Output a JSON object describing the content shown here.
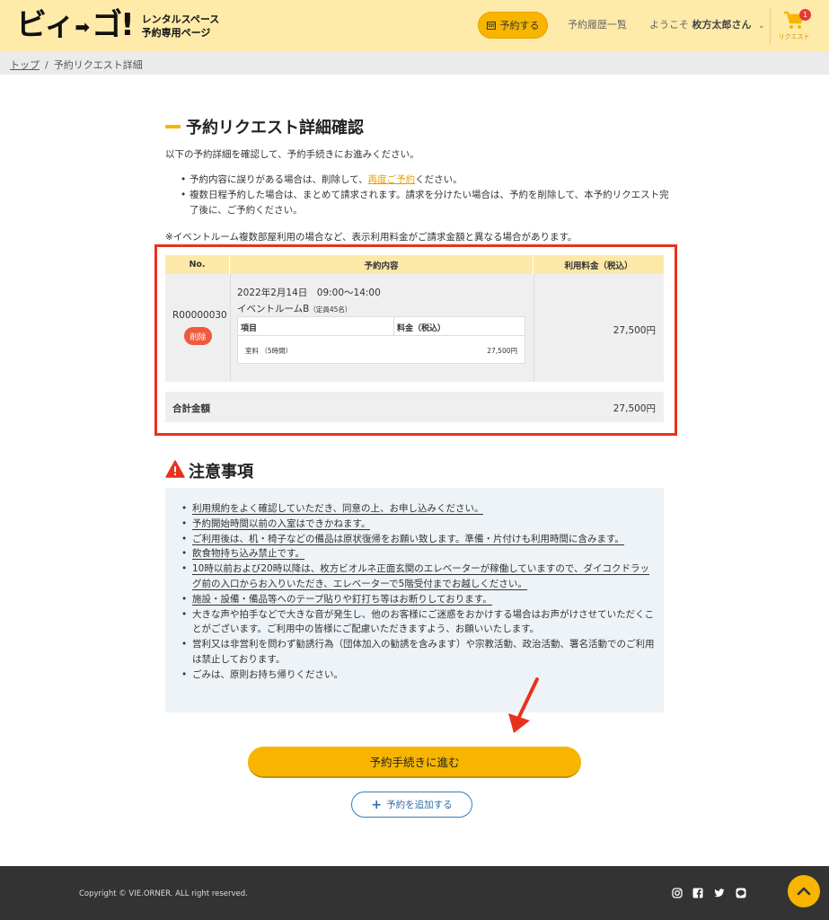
{
  "header": {
    "logo_text": "ビィ",
    "logo_text2": "ゴ!",
    "logo_sub1": "レンタルスペース",
    "logo_sub2": "予約専用ページ",
    "reserve_label": "予約する",
    "history_label": "予約履歴一覧",
    "welcome_prefix": "ようこそ",
    "user_name": "枚方太郎さん",
    "cart_badge": "1",
    "cart_label": "リクエスト"
  },
  "breadcrumb": {
    "home": "トップ",
    "separator": "/",
    "current": "予約リクエスト詳細"
  },
  "main": {
    "title": "予約リクエスト詳細確認",
    "intro": "以下の予約詳細を確認して、予約手続きにお進みください。",
    "bullet1_pre": "予約内容に誤りがある場合は、削除して、",
    "bullet1_link": "再度ご予約",
    "bullet1_post": "ください。",
    "bullet2": "複数日程予約した場合は、まとめて請求されます。請求を分けたい場合は、予約を削除して、本予約リクエスト完了後に、ご予約ください。",
    "note": "※イベントルーム複数部屋利用の場合など、表示利用料金がご請求金額と異なる場合があります。"
  },
  "table": {
    "headers": [
      "No.",
      "予約内容",
      "利用料金（税込）"
    ],
    "reservation_no": "R00000030",
    "delete_label": "削除",
    "date_time": "2022年2月14日　09:00〜14:00",
    "room": "イベントルームB",
    "capacity": "（定員45名）",
    "inner_headers": [
      "項目",
      "料金（税込）"
    ],
    "item_name": "室料 （5時間）",
    "item_price": "27,500円",
    "price": "27,500円",
    "total_label": "合計金額",
    "total_value": "27,500円"
  },
  "caution": {
    "title": "注意事項",
    "items": [
      "利用規約をよく確認していただき、同意の上、お申し込みください。",
      "予約開始時間以前の入室はできかねます。",
      "ご利用後は、机・椅子などの備品は原状復帰をお願い致します。準備・片付けも利用時間に含みます。",
      "飲食物持ち込み禁止です。",
      "10時以前および20時以降は、枚方ビオルネ正面玄関のエレベーターが稼働していますので、ダイコクドラッグ前の入口からお入りいただき、エレベーターで5階受付までお越しください。",
      "施設・設備・備品等へのテープ貼りや釘打ち等はお断りしております。",
      "大きな声や拍手などで大きな音が発生し、他のお客様にご迷惑をおかけする場合はお声がけさせていただくことがございます。ご利用中の皆様にご配慮いただきますよう、お願いいたします。",
      "営利又は非営利を問わず勧誘行為（団体加入の勧誘を含みます）や宗教活動、政治活動、署名活動でのご利用は禁止しております。",
      "ごみは、原則お持ち帰りください。"
    ]
  },
  "actions": {
    "proceed_label": "予約手続きに進む",
    "add_label": "予約を追加する"
  },
  "footer": {
    "copyright": "Copyright © VIE.ORNER. ALL right reserved."
  },
  "colors": {
    "accent": "#f7b500",
    "header_bg": "#feeaa9",
    "highlight": "#e8321e",
    "footer_bg": "#333333",
    "link_blue": "#2d6ea8"
  }
}
